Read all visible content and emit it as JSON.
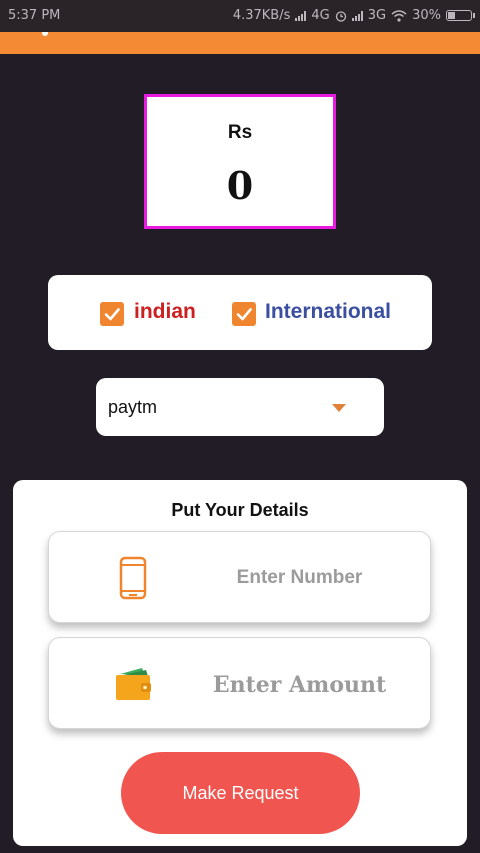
{
  "status_bar": {
    "time": "5:37 PM",
    "speed": "4.37KB/s",
    "network1": "4G",
    "network2": "3G",
    "battery": "30%",
    "battery_level": 0.3
  },
  "balance": {
    "currency": "Rs",
    "amount": "0"
  },
  "transfer_type": {
    "option1": {
      "label": "indian",
      "checked": true,
      "color": "#cc1f1f"
    },
    "option2": {
      "label": "International",
      "checked": true,
      "color": "#3a4fa0"
    }
  },
  "payment_method": {
    "selected": "paytm"
  },
  "details": {
    "title": "Put Your Details",
    "number_placeholder": "Enter Number",
    "amount_placeholder": "Enter Amount",
    "submit_label": "Make Request"
  },
  "colors": {
    "accent": "#f58a34",
    "highlight_border": "#e81be0",
    "button": "#f0564f",
    "background": "#211c25"
  },
  "icons": {
    "number_field": "smartphone-icon",
    "amount_field": "wallet-icon"
  }
}
